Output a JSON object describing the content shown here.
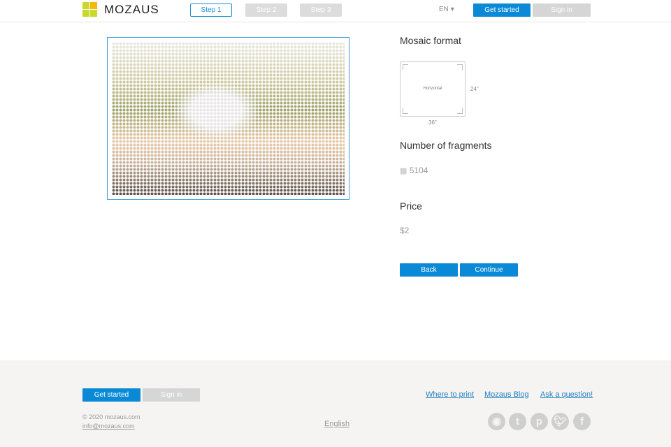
{
  "header": {
    "logo": "MOZAUS",
    "steps": [
      "Step 1",
      "Step 2",
      "Step 3"
    ],
    "language": "EN",
    "get_started": "Get started",
    "sign_in": "Sign in"
  },
  "format": {
    "title": "Mosaic format",
    "orientation": "Horizontal",
    "height": "24\"",
    "width": "36\""
  },
  "fragments": {
    "title": "Number of fragments",
    "count": "5104"
  },
  "price": {
    "title": "Price",
    "value": "$2"
  },
  "actions": {
    "back": "Back",
    "continue": "Continue"
  },
  "footer": {
    "get_started": "Get started",
    "sign_in": "Sign in",
    "links": [
      "Where to print",
      "Mozaus Blog",
      "Ask a question!"
    ],
    "copyright": "© 2020 mozaus.com",
    "email": "info@mozaus.com",
    "language": "English",
    "social": [
      "instagram",
      "tumblr",
      "pinterest",
      "twitter",
      "facebook"
    ]
  }
}
